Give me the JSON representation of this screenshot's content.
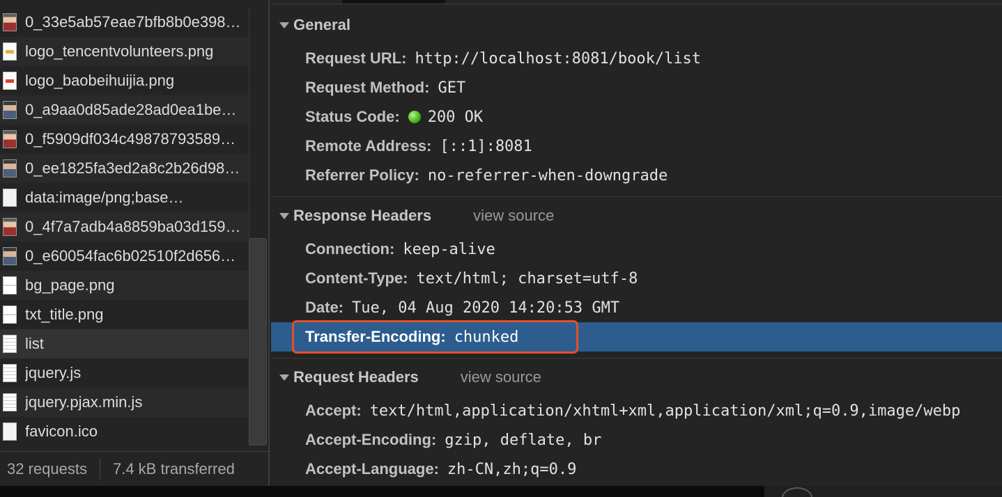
{
  "request_list": [
    {
      "name": "0_33e5ab57eae7bfb8b0e398…",
      "thumb": "photo",
      "selected": false
    },
    {
      "name": "logo_tencentvolunteers.png",
      "thumb": "logo-y",
      "selected": false
    },
    {
      "name": "logo_baobeihuijia.png",
      "thumb": "logo",
      "selected": false
    },
    {
      "name": "0_a9aa0d85ade28ad0ea1be…",
      "thumb": "photo2",
      "selected": false
    },
    {
      "name": "0_f5909df034c49878793589…",
      "thumb": "photo",
      "selected": false
    },
    {
      "name": "0_ee1825fa3ed2a8c2b26d98…",
      "thumb": "photo2",
      "selected": false
    },
    {
      "name": "data:image/png;base…",
      "thumb": "blank",
      "selected": false
    },
    {
      "name": "0_4f7a7adb4a8859ba03d159…",
      "thumb": "photo",
      "selected": false
    },
    {
      "name": "0_e60054fac6b02510f2d656…",
      "thumb": "photo2",
      "selected": false
    },
    {
      "name": "bg_page.png",
      "thumb": "bar",
      "selected": false
    },
    {
      "name": "txt_title.png",
      "thumb": "bar",
      "selected": false
    },
    {
      "name": "list",
      "thumb": "doc",
      "selected": true
    },
    {
      "name": "jquery.js",
      "thumb": "doc",
      "selected": false
    },
    {
      "name": "jquery.pjax.min.js",
      "thumb": "doc",
      "selected": false
    },
    {
      "name": "favicon.ico",
      "thumb": "blank",
      "selected": false
    }
  ],
  "status": {
    "requests": "32 requests",
    "transferred": "7.4 kB transferred"
  },
  "general": {
    "title": "General",
    "rows": [
      {
        "key": "Request URL:",
        "value": "http://localhost:8081/book/list"
      },
      {
        "key": "Request Method:",
        "value": "GET"
      },
      {
        "key": "Status Code:",
        "value": "200 OK",
        "status_dot": "green"
      },
      {
        "key": "Remote Address:",
        "value": "[::1]:8081"
      },
      {
        "key": "Referrer Policy:",
        "value": "no-referrer-when-downgrade"
      }
    ]
  },
  "response_headers": {
    "title": "Response Headers",
    "view_source": "view source",
    "rows": [
      {
        "key": "Connection:",
        "value": "keep-alive"
      },
      {
        "key": "Content-Type:",
        "value": "text/html; charset=utf-8"
      },
      {
        "key": "Date:",
        "value": "Tue, 04 Aug 2020 14:20:53 GMT"
      },
      {
        "key": "Transfer-Encoding:",
        "value": "chunked",
        "highlighted": true
      }
    ]
  },
  "request_headers": {
    "title": "Request Headers",
    "view_source": "view source",
    "rows": [
      {
        "key": "Accept:",
        "value": "text/html,application/xhtml+xml,application/xml;q=0.9,image/webp"
      },
      {
        "key": "Accept-Encoding:",
        "value": "gzip, deflate, br"
      },
      {
        "key": "Accept-Language:",
        "value": "zh-CN,zh;q=0.9"
      }
    ]
  },
  "colors": {
    "highlight_row": "#2c5d8e",
    "callout_border": "#e64f2a",
    "status_ok": "#3fb31c"
  }
}
